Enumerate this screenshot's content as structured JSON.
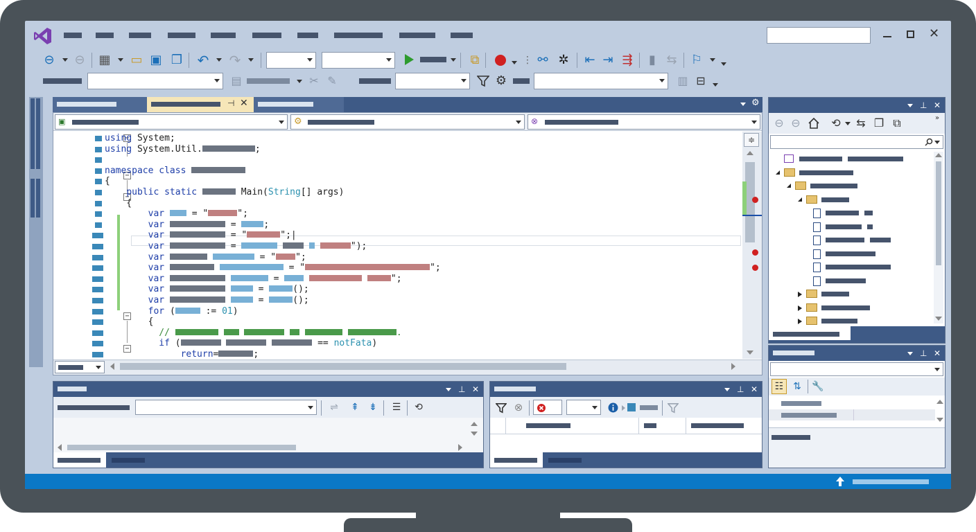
{
  "editor": {
    "code_lines": [
      {
        "tokens": [
          {
            "t": "using ",
            "c": "kw"
          },
          {
            "t": "System;"
          }
        ]
      },
      {
        "tokens": [
          {
            "t": "using ",
            "c": "kw"
          },
          {
            "t": "System.Util."
          },
          {
            "m": "g",
            "w": 76
          },
          {
            "t": ";"
          }
        ]
      },
      {
        "tokens": []
      },
      {
        "tokens": [
          {
            "t": "namespace ",
            "c": "kw"
          },
          {
            "t": "class ",
            "c": "kw"
          },
          {
            "m": "g",
            "w": 78
          }
        ]
      },
      {
        "tokens": [
          {
            "t": "{"
          }
        ]
      },
      {
        "tokens": [
          {
            "t": "    "
          },
          {
            "t": "public ",
            "c": "kw"
          },
          {
            "t": "static ",
            "c": "kw"
          },
          {
            "m": "g",
            "w": 48
          },
          {
            "t": " Main("
          },
          {
            "t": "String",
            "c": "ty"
          },
          {
            "t": "[] args)"
          }
        ]
      },
      {
        "tokens": [
          {
            "t": "    {"
          }
        ]
      },
      {
        "tokens": [
          {
            "t": "        "
          },
          {
            "t": "var ",
            "c": "kw"
          },
          {
            "m": "b",
            "w": 24
          },
          {
            "t": " = \""
          },
          {
            "m": "r",
            "w": 42
          },
          {
            "t": "\";"
          }
        ]
      },
      {
        "tokens": [
          {
            "t": "        "
          },
          {
            "t": "var ",
            "c": "kw"
          },
          {
            "m": "g",
            "w": 80
          },
          {
            "t": " = "
          },
          {
            "m": "b",
            "w": 32
          },
          {
            "t": ";"
          }
        ]
      },
      {
        "tokens": [
          {
            "t": "        "
          },
          {
            "t": "var ",
            "c": "kw"
          },
          {
            "m": "g",
            "w": 80
          },
          {
            "t": " = \""
          },
          {
            "m": "r",
            "w": 48
          },
          {
            "t": "\";|"
          }
        ]
      },
      {
        "tokens": [
          {
            "t": "        "
          },
          {
            "t": "var ",
            "c": "kw"
          },
          {
            "m": "g",
            "w": 80
          },
          {
            "t": " = "
          },
          {
            "m": "b",
            "w": 52
          },
          {
            "t": " "
          },
          {
            "m": "g",
            "w": 30
          },
          {
            "t": " "
          },
          {
            "m": "b",
            "w": 8
          },
          {
            "t": " "
          },
          {
            "m": "r",
            "w": 44
          },
          {
            "t": "\");"
          }
        ]
      },
      {
        "tokens": [
          {
            "t": "        "
          },
          {
            "t": "var ",
            "c": "kw"
          },
          {
            "m": "g",
            "w": 54
          },
          {
            "t": " "
          },
          {
            "m": "b",
            "w": 60
          },
          {
            "t": " = \""
          },
          {
            "m": "r",
            "w": 28
          },
          {
            "t": "\";"
          }
        ]
      },
      {
        "tokens": [
          {
            "t": "        "
          },
          {
            "t": "var ",
            "c": "kw"
          },
          {
            "m": "g",
            "w": 64
          },
          {
            "t": " "
          },
          {
            "m": "b",
            "w": 92
          },
          {
            "t": " = \""
          },
          {
            "m": "r",
            "w": 180
          },
          {
            "t": "\";"
          }
        ]
      },
      {
        "tokens": [
          {
            "t": "        "
          },
          {
            "t": "var ",
            "c": "kw"
          },
          {
            "m": "g",
            "w": 80
          },
          {
            "t": " "
          },
          {
            "m": "b",
            "w": 54
          },
          {
            "t": " = "
          },
          {
            "m": "b",
            "w": 28
          },
          {
            "t": " "
          },
          {
            "m": "r",
            "w": 76
          },
          {
            "t": " "
          },
          {
            "m": "r",
            "w": 34
          },
          {
            "t": "\";"
          }
        ]
      },
      {
        "tokens": [
          {
            "t": "        "
          },
          {
            "t": "var ",
            "c": "kw"
          },
          {
            "m": "g",
            "w": 80
          },
          {
            "t": " "
          },
          {
            "m": "b",
            "w": 32
          },
          {
            "t": " = "
          },
          {
            "m": "b",
            "w": 34
          },
          {
            "t": "();"
          }
        ]
      },
      {
        "tokens": [
          {
            "t": "        "
          },
          {
            "t": "var ",
            "c": "kw"
          },
          {
            "m": "g",
            "w": 80
          },
          {
            "t": " "
          },
          {
            "m": "b",
            "w": 32
          },
          {
            "t": " = "
          },
          {
            "m": "b",
            "w": 34
          },
          {
            "t": "();"
          }
        ]
      },
      {
        "tokens": [
          {
            "t": "        "
          },
          {
            "t": "for ",
            "c": "kw"
          },
          {
            "t": "("
          },
          {
            "m": "b",
            "w": 36
          },
          {
            "t": " := "
          },
          {
            "t": "01",
            "c": "ty"
          },
          {
            "t": ")"
          }
        ]
      },
      {
        "tokens": [
          {
            "t": "        {"
          }
        ]
      },
      {
        "tokens": [
          {
            "t": "          "
          },
          {
            "t": "// ",
            "c": "gr"
          },
          {
            "m": "gr",
            "w": 62
          },
          {
            "t": " "
          },
          {
            "m": "gr",
            "w": 22
          },
          {
            "t": " "
          },
          {
            "m": "gr",
            "w": 58
          },
          {
            "t": " "
          },
          {
            "m": "gr",
            "w": 14
          },
          {
            "t": " "
          },
          {
            "m": "gr",
            "w": 54
          },
          {
            "t": " "
          },
          {
            "m": "gr",
            "w": 70
          },
          {
            "t": ".",
            "c": "gr"
          }
        ]
      },
      {
        "tokens": [
          {
            "t": "          "
          },
          {
            "t": "if ",
            "c": "kw"
          },
          {
            "t": "("
          },
          {
            "m": "g",
            "w": 58
          },
          {
            "t": " "
          },
          {
            "m": "g",
            "w": 58
          },
          {
            "t": " "
          },
          {
            "m": "g",
            "w": 58
          },
          {
            "t": " == "
          },
          {
            "t": "notFata",
            "c": "ty"
          },
          {
            "t": ")"
          }
        ]
      },
      {
        "tokens": [
          {
            "t": "              "
          },
          {
            "t": "return",
            "c": "kw"
          },
          {
            "t": "="
          },
          {
            "m": "g",
            "w": 50
          },
          {
            "t": ";"
          }
        ]
      }
    ]
  },
  "colors": {
    "accent": "#0078c8",
    "titlebar": "#3e5a86",
    "screen_bg": "#bfcde0",
    "statusbar": "#0b78c6",
    "vs_logo": "#7a3fb0",
    "run_green": "#2e9b2e",
    "breakpoint_red": "#d02020"
  },
  "icons": {
    "logo": "visual-studio-logo-icon",
    "run": "run-triangle-icon",
    "breakpoint": "breakpoint-circle-icon",
    "search": "search-icon",
    "home": "home-icon",
    "filter": "filter-icon",
    "wrench": "wrench-icon",
    "info": "info-icon",
    "error": "error-icon",
    "up_arrow": "up-arrow-icon"
  }
}
